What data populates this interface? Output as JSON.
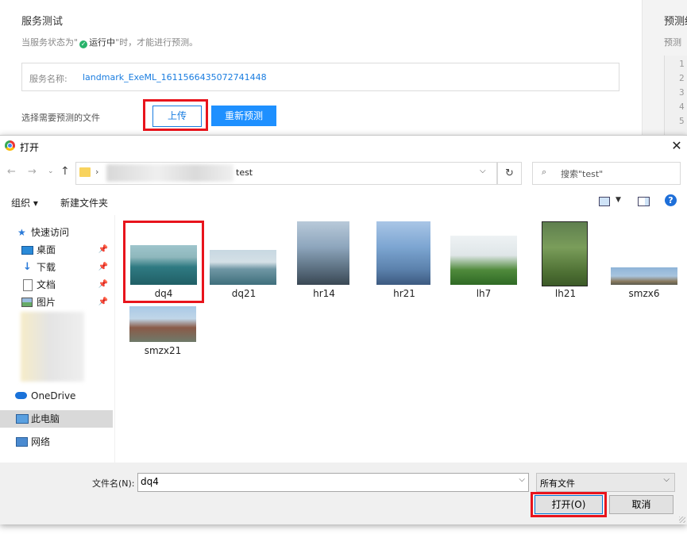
{
  "web_page": {
    "section_title": "服务测试",
    "status_prefix": "当服务状态为\"",
    "status_value": "运行中",
    "status_suffix": "\"时，才能进行预测。",
    "service_name_label": "服务名称:",
    "service_name_value": "landmark_ExeML_1611566435072741448",
    "file_select_label": "选择需要预测的文件",
    "upload_button": "上传",
    "repredict_button": "重新预测",
    "right_panel_title": "预测结",
    "right_panel_sub": "预测",
    "line_numbers": [
      "1",
      "2",
      "3",
      "4",
      "5"
    ]
  },
  "dialog": {
    "title": "打开",
    "path_last": "test",
    "search_placeholder": "搜索\"test\"",
    "organize_label": "组织 ▾",
    "new_folder_label": "新建文件夹",
    "nav": [
      {
        "label": "快速访问",
        "icon": "star-icon"
      },
      {
        "label": "桌面",
        "icon": "desktop-icon"
      },
      {
        "label": "下载",
        "icon": "download-icon"
      },
      {
        "label": "文档",
        "icon": "document-icon"
      },
      {
        "label": "图片",
        "icon": "pictures-icon"
      },
      {
        "label": "OneDrive",
        "icon": "cloud-icon"
      },
      {
        "label": "此电脑",
        "icon": "computer-icon"
      },
      {
        "label": "网络",
        "icon": "network-icon"
      }
    ],
    "files": [
      {
        "name": "dq4"
      },
      {
        "name": "dq21"
      },
      {
        "name": "hr14"
      },
      {
        "name": "hr21"
      },
      {
        "name": "lh7"
      },
      {
        "name": "lh21"
      },
      {
        "name": "smzx6"
      },
      {
        "name": "smzx21"
      }
    ],
    "filename_label": "文件名(N):",
    "filename_value": "dq4",
    "filter_value": "所有文件",
    "open_button": "打开(O)",
    "cancel_button": "取消",
    "colors": {
      "highlight": "#e8141c",
      "accent": "#0078d7",
      "link": "#1a7de0"
    }
  }
}
